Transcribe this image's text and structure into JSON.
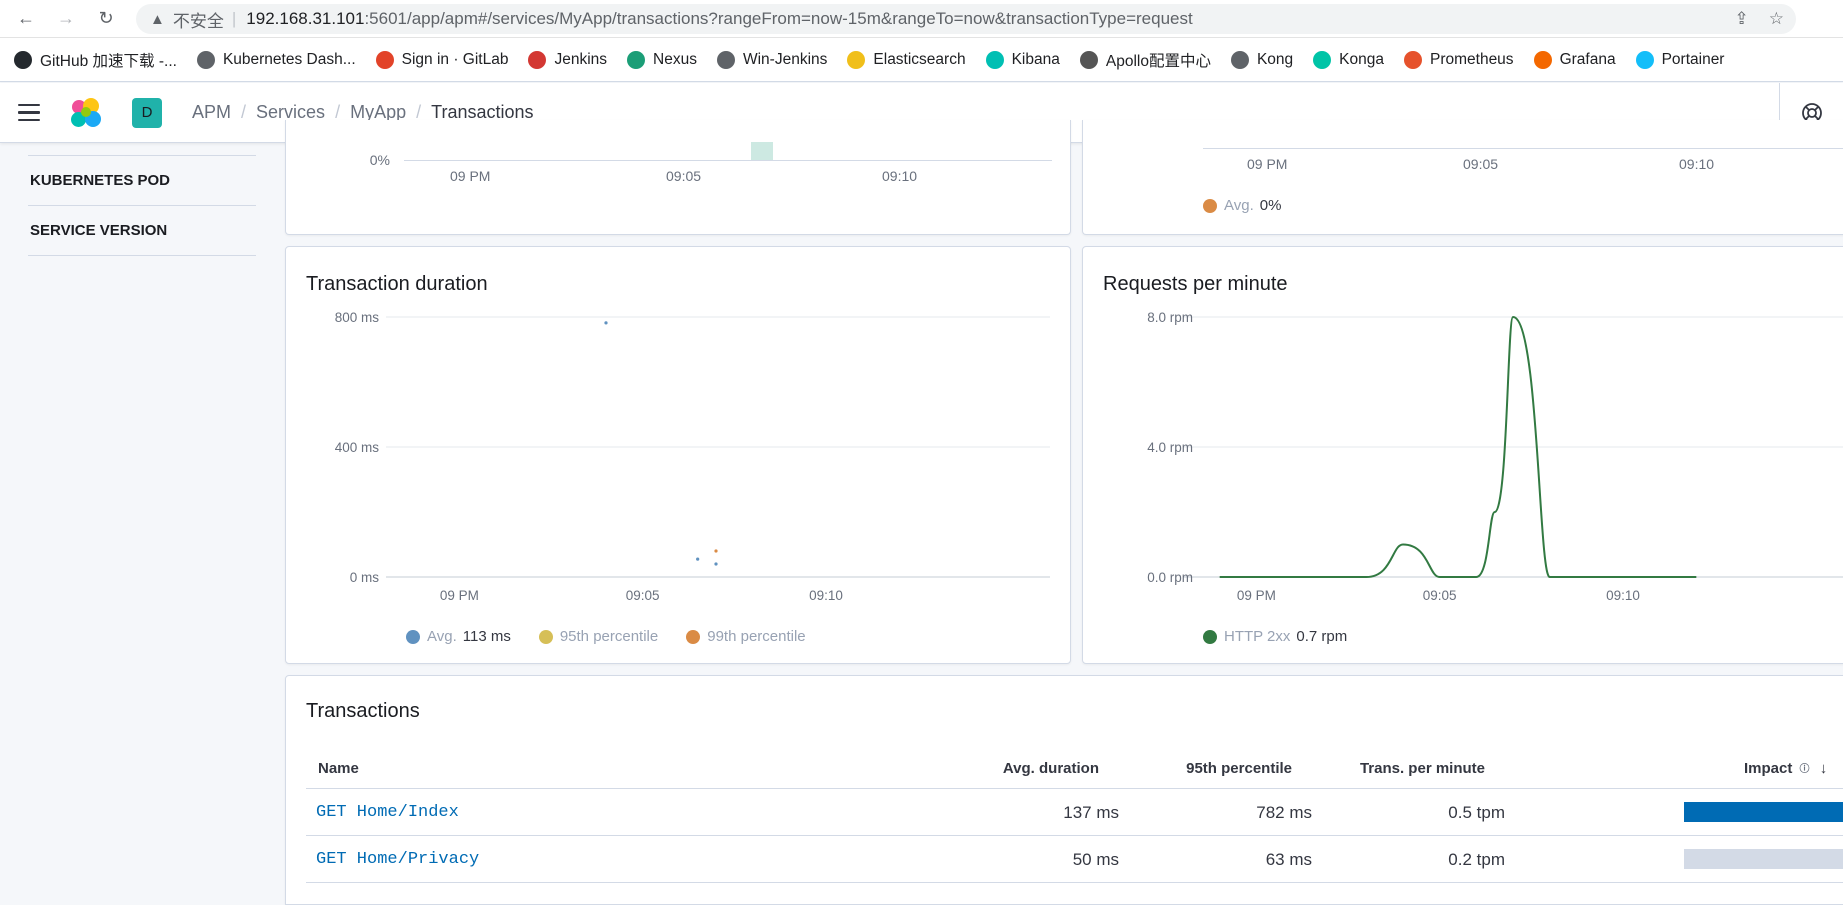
{
  "browser": {
    "insecure_label": "不安全",
    "url_host": "192.168.31.101",
    "url_rest": ":5601/app/apm#/services/MyApp/transactions?rangeFrom=now-15m&rangeTo=now&transactionType=request",
    "bookmarks": [
      {
        "label": "GitHub 加速下载 -...",
        "icon": "github-icon",
        "color": "#24292e"
      },
      {
        "label": "Kubernetes Dash...",
        "icon": "globe-icon",
        "color": "#5f6368"
      },
      {
        "label": "Sign in · GitLab",
        "icon": "gitlab-icon",
        "color": "#e24329"
      },
      {
        "label": "Jenkins",
        "icon": "jenkins-icon",
        "color": "#d33833"
      },
      {
        "label": "Nexus",
        "icon": "nexus-icon",
        "color": "#1b9e77"
      },
      {
        "label": "Win-Jenkins",
        "icon": "globe-icon",
        "color": "#5f6368"
      },
      {
        "label": "Elasticsearch",
        "icon": "elasticsearch-icon",
        "color": "#f0bf1a"
      },
      {
        "label": "Kibana",
        "icon": "kibana-icon",
        "color": "#00bfb3"
      },
      {
        "label": "Apollo配置中心",
        "icon": "apollo-icon",
        "color": "#555555"
      },
      {
        "label": "Kong",
        "icon": "globe-icon",
        "color": "#5f6368"
      },
      {
        "label": "Konga",
        "icon": "konga-icon",
        "color": "#00c4a7"
      },
      {
        "label": "Prometheus",
        "icon": "prometheus-icon",
        "color": "#e6522c"
      },
      {
        "label": "Grafana",
        "icon": "grafana-icon",
        "color": "#f46800"
      },
      {
        "label": "Portainer",
        "icon": "portainer-icon",
        "color": "#13bef9"
      }
    ]
  },
  "header": {
    "space_initial": "D",
    "breadcrumbs": [
      "APM",
      "Services",
      "MyApp",
      "Transactions"
    ]
  },
  "sidebar": {
    "items": [
      "KUBERNETES POD",
      "SERVICE VERSION"
    ]
  },
  "top_left_panel": {
    "y_tick": "0%",
    "x_ticks": [
      "09 PM",
      "09:05",
      "09:10"
    ]
  },
  "top_right_panel": {
    "x_ticks": [
      "09 PM",
      "09:05",
      "09:10"
    ],
    "legend": {
      "label": "Avg.",
      "value": "0%",
      "color": "#da8b45"
    }
  },
  "duration_panel": {
    "title": "Transaction duration",
    "legend": [
      {
        "label": "Avg.",
        "value": "113 ms",
        "color": "#6092c0"
      },
      {
        "label": "95th percentile",
        "value": "",
        "color": "#d6bf57"
      },
      {
        "label": "99th percentile",
        "value": "",
        "color": "#da8b45"
      }
    ]
  },
  "rpm_panel": {
    "title": "Requests per minute",
    "legend": {
      "label": "HTTP 2xx",
      "value": "0.7 rpm",
      "color": "#327a42"
    }
  },
  "chart_data": [
    {
      "type": "scatter",
      "title": "Transaction duration",
      "x_ticks": [
        "09 PM",
        "09:05",
        "09:10"
      ],
      "y_ticks": [
        "800 ms",
        "400 ms",
        "0 ms"
      ],
      "ylim": [
        0,
        800
      ],
      "series": [
        {
          "name": "Avg.",
          "color": "#6092c0",
          "points": [
            {
              "x": "09:04",
              "y": 782
            },
            {
              "x": "09:06:30",
              "y": 55
            },
            {
              "x": "09:07",
              "y": 40
            }
          ]
        },
        {
          "name": "95th percentile",
          "color": "#d6bf57",
          "points": []
        },
        {
          "name": "99th percentile",
          "color": "#da8b45",
          "points": [
            {
              "x": "09:07",
              "y": 80
            }
          ]
        }
      ]
    },
    {
      "type": "line",
      "title": "Requests per minute",
      "x_ticks": [
        "09 PM",
        "09:05",
        "09:10"
      ],
      "y_ticks": [
        "8.0 rpm",
        "4.0 rpm",
        "0.0 rpm"
      ],
      "ylim": [
        0,
        8
      ],
      "series": [
        {
          "name": "HTTP 2xx",
          "color": "#327a42",
          "x": [
            "08:59",
            "09:00",
            "09:01",
            "09:02",
            "09:03",
            "09:04",
            "09:05",
            "09:06",
            "09:06:30",
            "09:07",
            "09:08",
            "09:09",
            "09:10",
            "09:11",
            "09:12"
          ],
          "values": [
            0,
            0,
            0,
            0,
            0,
            1,
            0,
            0,
            2,
            8,
            0,
            0,
            0,
            0,
            0
          ]
        }
      ]
    }
  ],
  "transactions": {
    "title": "Transactions",
    "columns": {
      "name": "Name",
      "avg": "Avg. duration",
      "p95": "95th percentile",
      "tpm": "Trans. per minute",
      "impact": "Impact"
    },
    "rows": [
      {
        "name": "GET Home/Index",
        "avg": "137 ms",
        "p95": "782 ms",
        "tpm": "0.5 tpm",
        "impact": 1.0
      },
      {
        "name": "GET Home/Privacy",
        "avg": "50 ms",
        "p95": "63 ms",
        "tpm": "0.2 tpm",
        "impact": 0.0
      }
    ]
  }
}
